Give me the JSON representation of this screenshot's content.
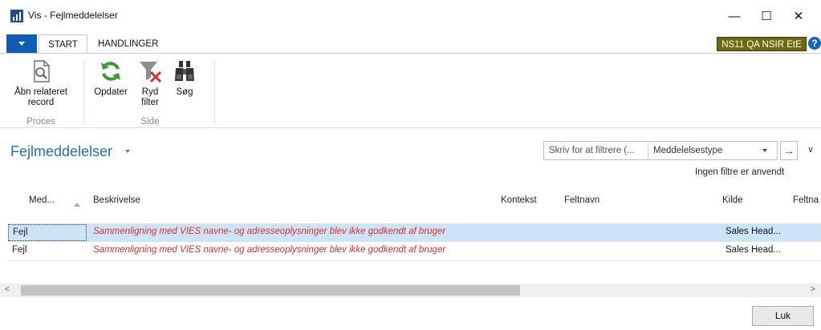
{
  "window": {
    "title": "Vis - Fejlmeddelelser",
    "minimize_glyph": "—",
    "maximize_glyph": "☐",
    "close_glyph": "✕"
  },
  "ribbon": {
    "tabs": [
      {
        "label": "START",
        "active": true
      },
      {
        "label": "HANDLINGER",
        "active": false
      }
    ],
    "company": "NS11 QA NSIR EtE",
    "help_glyph": "?",
    "groups": [
      {
        "label": "Proces",
        "buttons": [
          {
            "label_line1": "Åbn relateret",
            "label_line2": "record",
            "icon": "document-search-icon"
          }
        ]
      },
      {
        "label": "Side",
        "buttons": [
          {
            "label_line1": "Opdater",
            "label_line2": "",
            "icon": "refresh-icon"
          },
          {
            "label_line1": "Ryd",
            "label_line2": "filter",
            "icon": "clear-filter-icon"
          },
          {
            "label_line1": "Søg",
            "label_line2": "",
            "icon": "binoculars-icon"
          }
        ]
      }
    ]
  },
  "page": {
    "title": "Fejlmeddelelser",
    "filter": {
      "placeholder": "Skriv for at filtrere (...",
      "field": "Meddelelsestype",
      "go_glyph": "→"
    },
    "no_filters": "Ingen filtre er anvendt"
  },
  "grid": {
    "columns": [
      "Med...",
      "Beskrivelse",
      "Kontekst",
      "Feltnavn",
      "Kilde",
      "Feltna"
    ],
    "rows": [
      {
        "type": "Fejl",
        "description": "Sammenligning med VIES navne- og adresseoplysninger blev ikke godkendt af bruger",
        "source": "Sales Head...",
        "selected": true
      },
      {
        "type": "Fejl",
        "description": "Sammenligning med VIES navne- og adresseoplysninger blev ikke godkendt af bruger",
        "source": "Sales Head...",
        "selected": false
      }
    ]
  },
  "scrollbar": {
    "left_glyph": "<",
    "right_glyph": ">"
  },
  "footer": {
    "close_label": "Luk"
  },
  "colors": {
    "accent_blue": "#0b5db5",
    "title_blue": "#1f6fb2",
    "company_badge": "#6b6b0a",
    "error_red": "#d9302b",
    "selection": "#cde4f7"
  }
}
